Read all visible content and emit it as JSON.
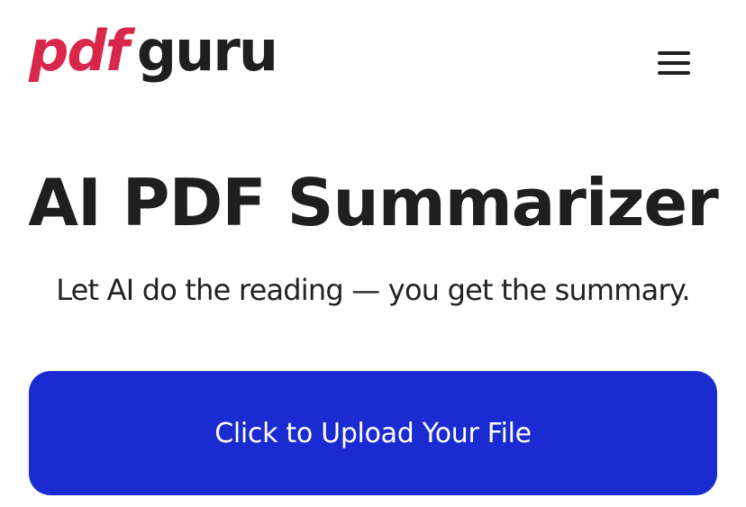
{
  "header": {
    "logo": {
      "part1": "pdf",
      "part2": "guru"
    }
  },
  "hero": {
    "title": "AI PDF Summarizer",
    "subtitle": "Let AI do the reading — you get the summary."
  },
  "upload": {
    "label": "Click to Upload Your File"
  },
  "colors": {
    "brand_red": "#d8274a",
    "primary_blue": "#1a2bd1",
    "text_dark": "#1f1f1f",
    "background": "#ffffff"
  },
  "icons": {
    "menu": "hamburger-menu-icon"
  }
}
